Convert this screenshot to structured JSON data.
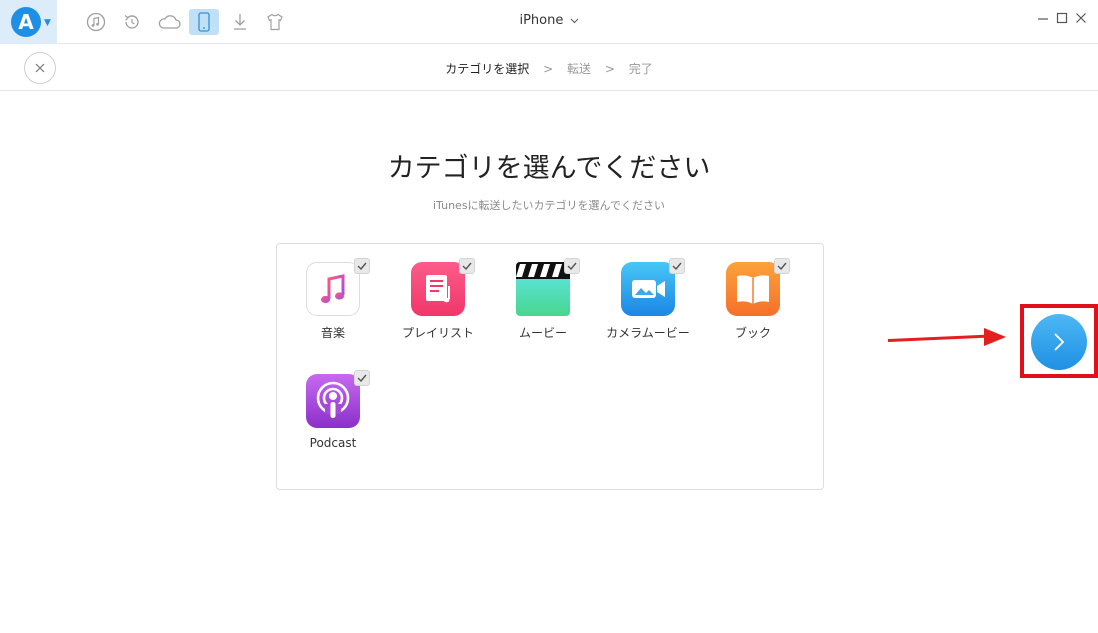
{
  "app": {
    "logo_letter": "A",
    "title": "iPhone",
    "toolbar_icons": [
      "music-icon",
      "restore-icon",
      "cloud-icon",
      "phone-icon",
      "download-icon",
      "shirt-icon"
    ],
    "active_toolbar_icon": "phone-icon",
    "window_controls": {
      "minimize": "—",
      "maximize": "☐",
      "close": "✕"
    }
  },
  "breadcrumb": {
    "steps": [
      "カテゴリを選択",
      "転送",
      "完了"
    ],
    "separator": ">",
    "current_index": 0
  },
  "main": {
    "heading": "カテゴリを選んでください",
    "subheading": "iTunesに転送したいカテゴリを選んでください"
  },
  "categories": [
    {
      "label": "音楽",
      "icon": "music-note-icon",
      "checked": true
    },
    {
      "label": "プレイリスト",
      "icon": "playlist-icon",
      "checked": true
    },
    {
      "label": "ムービー",
      "icon": "clapperboard-icon",
      "checked": true
    },
    {
      "label": "カメラムービー",
      "icon": "video-camera-icon",
      "checked": true
    },
    {
      "label": "ブック",
      "icon": "book-icon",
      "checked": true
    },
    {
      "label": "Podcast",
      "icon": "podcast-icon",
      "checked": true
    }
  ],
  "colors": {
    "accent": "#1f8fe6",
    "annotation": "#e51e1e"
  }
}
